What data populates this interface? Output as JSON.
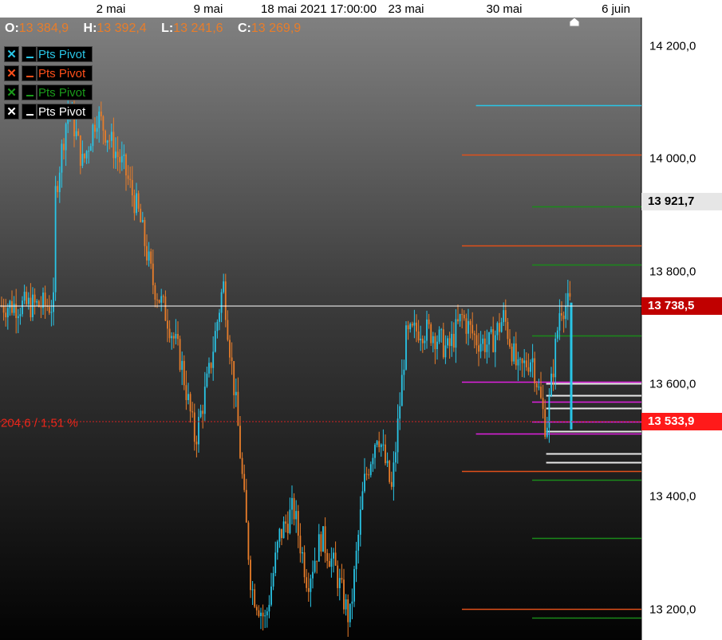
{
  "header": {
    "dates": [
      "2 mai",
      "9 mai",
      "23 mai",
      "30 mai",
      "6 juin"
    ],
    "cursor_date": "18 mai 2021 17:00:00"
  },
  "ohlc": {
    "o_label": "O:",
    "o_value": "13 384,9",
    "h_label": "H:",
    "h_value": "13 392,4",
    "l_label": "L:",
    "l_value": "13 241,6",
    "c_label": "C:",
    "c_value": "13 269,9"
  },
  "legend": [
    {
      "label": "Pts Pivot",
      "color": "#29c5e6"
    },
    {
      "label": "Pts Pivot",
      "color": "#ff4f1a"
    },
    {
      "label": "Pts Pivot",
      "color": "#1a9a1a"
    },
    {
      "label": "Pts Pivot",
      "color": "#ffffff"
    }
  ],
  "variation_label": "204,6 / 1,51 %",
  "colors": {
    "up": "#29c5e6",
    "down": "#e87d2a",
    "axis_bg": "#ffffff",
    "current_price_bg": "#c00000",
    "marker_price_bg": "#ff1a1a"
  },
  "chart_data": {
    "type": "candlestick",
    "y_tick_labels": [
      "14 200,0",
      "14 000,0",
      "13 800,0",
      "13 600,0",
      "13 400,0",
      "13 200,0"
    ],
    "y_ticks": [
      14200,
      14000,
      13800,
      13600,
      13400,
      13200
    ],
    "ylim": [
      13150,
      14245
    ],
    "x_tick_labels": [
      "2 mai",
      "9 mai",
      "23 mai",
      "30 mai",
      "6 juin"
    ],
    "price_tags": [
      {
        "label": "13 921,7",
        "value": 13921.7,
        "style": "last"
      },
      {
        "label": "13 738,5",
        "value": 13738.5,
        "style": "current"
      },
      {
        "label": "13 533,9",
        "value": 13533.9,
        "style": "marker"
      }
    ],
    "pivot_levels": [
      {
        "series": "cyan",
        "color": "#29c5e6",
        "value": 14095,
        "from": "28 mai"
      },
      {
        "series": "orange",
        "color": "#e0501a",
        "value": 14007,
        "from": "27 mai"
      },
      {
        "series": "orange",
        "color": "#e0501a",
        "value": 13846,
        "from": "27 mai"
      },
      {
        "series": "orange",
        "color": "#e0501a",
        "value": 13446,
        "from": "27 mai"
      },
      {
        "series": "orange",
        "color": "#e0501a",
        "value": 13201,
        "from": "27 mai"
      },
      {
        "series": "green",
        "color": "#1a8a1a",
        "value": 13916,
        "from": "1 juin"
      },
      {
        "series": "green",
        "color": "#1a8a1a",
        "value": 13812,
        "from": "1 juin"
      },
      {
        "series": "green",
        "color": "#1a8a1a",
        "value": 13687,
        "from": "1 juin"
      },
      {
        "series": "green",
        "color": "#1a8a1a",
        "value": 13431,
        "from": "1 juin"
      },
      {
        "series": "green",
        "color": "#1a8a1a",
        "value": 13327,
        "from": "1 juin"
      },
      {
        "series": "green",
        "color": "#1a8a1a",
        "value": 13186,
        "from": "1 juin"
      },
      {
        "series": "magenta",
        "color": "#e020e0",
        "value": 13604,
        "from": "27 mai"
      },
      {
        "series": "magenta",
        "color": "#e020e0",
        "value": 13569,
        "from": "1 juin"
      },
      {
        "series": "magenta",
        "color": "#e020e0",
        "value": 13534,
        "from": "1 juin"
      },
      {
        "series": "magenta",
        "color": "#e020e0",
        "value": 13513,
        "from": "28 mai"
      },
      {
        "series": "white",
        "color": "#e8e8e8",
        "value": 13602,
        "from": "2 juin"
      },
      {
        "series": "white",
        "color": "#e8e8e8",
        "value": 13580,
        "from": "2 juin"
      },
      {
        "series": "white",
        "color": "#e8e8e8",
        "value": 13558,
        "from": "2 juin"
      },
      {
        "series": "white",
        "color": "#e8e8e8",
        "value": 13517,
        "from": "2 juin"
      },
      {
        "series": "white",
        "color": "#e8e8e8",
        "value": 13477,
        "from": "2 juin"
      },
      {
        "series": "white",
        "color": "#e8e8e8",
        "value": 13461,
        "from": "2 juin"
      }
    ],
    "price_path": [
      {
        "date": "28 avr",
        "price": 13930
      },
      {
        "date": "29 avr",
        "price": 14100
      },
      {
        "date": "30 avr",
        "price": 13990
      },
      {
        "date": "1 mai",
        "price": 14080
      },
      {
        "date": "3 mai",
        "price": 13980
      },
      {
        "date": "4 mai",
        "price": 13900
      },
      {
        "date": "5 mai",
        "price": 13780
      },
      {
        "date": "6 mai",
        "price": 13720
      },
      {
        "date": "7 mai",
        "price": 13640
      },
      {
        "date": "8 mai",
        "price": 13500
      },
      {
        "date": "9 mai",
        "price": 13620
      },
      {
        "date": "10 mai",
        "price": 13780
      },
      {
        "date": "11 mai",
        "price": 13540
      },
      {
        "date": "12 mai",
        "price": 13240
      },
      {
        "date": "13 mai",
        "price": 13180
      },
      {
        "date": "14 mai",
        "price": 13330
      },
      {
        "date": "15 mai",
        "price": 13380
      },
      {
        "date": "16 mai",
        "price": 13250
      },
      {
        "date": "17 mai",
        "price": 13330
      },
      {
        "date": "18 mai",
        "price": 13270
      },
      {
        "date": "19 mai",
        "price": 13180
      },
      {
        "date": "20 mai",
        "price": 13420
      },
      {
        "date": "21 mai",
        "price": 13520
      },
      {
        "date": "22 mai",
        "price": 13410
      },
      {
        "date": "23 mai",
        "price": 13680
      },
      {
        "date": "24 mai",
        "price": 13700
      },
      {
        "date": "25 mai",
        "price": 13690
      },
      {
        "date": "26 mai",
        "price": 13660
      },
      {
        "date": "27 mai",
        "price": 13720
      },
      {
        "date": "28 mai",
        "price": 13680
      },
      {
        "date": "29 mai",
        "price": 13670
      },
      {
        "date": "30 mai",
        "price": 13720
      },
      {
        "date": "31 mai",
        "price": 13620
      },
      {
        "date": "1 juin",
        "price": 13650
      },
      {
        "date": "2 juin",
        "price": 13520
      },
      {
        "date": "3 juin",
        "price": 13740
      }
    ]
  }
}
